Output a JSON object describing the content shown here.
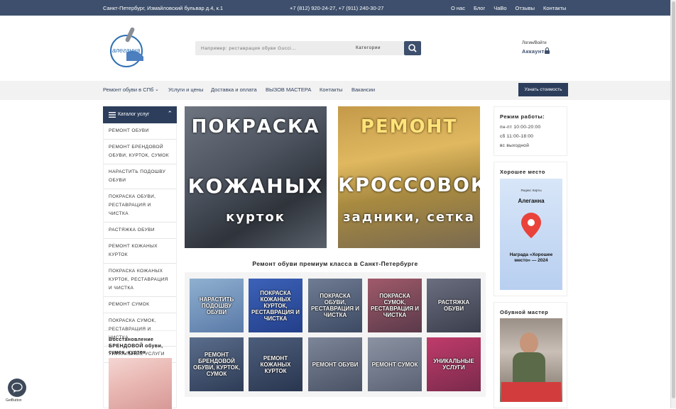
{
  "topbar": {
    "address": "Санкт-Петербург, Измайловский бульвар д.4, к.1",
    "phones": "+7 (812) 920-24-27, +7 (911) 240-30-27",
    "links": [
      "О нас",
      "Блог",
      "ЧаВо",
      "Отзывы",
      "Контакты"
    ]
  },
  "header": {
    "search_placeholder": "Например: реставрация обуви Gucci...",
    "category_label": "Категории",
    "login_label": "Логин/Войти",
    "account_label": "Аккаунт",
    "logo_text": "Алеганна"
  },
  "nav": {
    "items": [
      "Ремонт обуви в СПб",
      "Услуги и цены",
      "Доставка и оплата",
      "ВЫЗОВ МАСТЕРА",
      "Контакты",
      "Вакансии"
    ],
    "cta": "Узнать стоимость"
  },
  "catalog": {
    "title": "Каталог услуг",
    "items": [
      "Ремонт обуви",
      "Ремонт брендовой обуви, курток, сумок",
      "Нарастить подошву обуви",
      "Покраска обуви, реставрация и чистка",
      "Растяжка обуви",
      "Ремонт кожаных курток",
      "Покраска кожаных курток, реставрация и чистка",
      "Ремонт сумок",
      "Покраска сумок, реставрация и чистка",
      "Уникальные услуги"
    ],
    "promo_title": "Восстановление БРЕНДОВОЙ обуви, сумок, курток"
  },
  "banners": [
    {
      "line1": "ПОКРАСКА",
      "line2": "КОЖАНЫХ",
      "line3": "курток"
    },
    {
      "line1": "РЕМОНТ",
      "line2": "КРОССОВОК",
      "line3": "задники, сетка"
    }
  ],
  "section_title": "Ремонт обуви премиум класса в Санкт-Петербурге",
  "tiles": [
    "Нарастить подошву обуви",
    "Покраска кожаных курток, реставрация и чистка",
    "Покраска обуви, реставрация и чистка",
    "Покраска сумок, реставрация и чистка",
    "Растяжка обуви",
    "Ремонт брендовой обуви, курток, сумок",
    "Ремонт кожаных курток",
    "Ремонт обуви",
    "Ремонт сумок",
    "Уникальные услуги"
  ],
  "hours": {
    "title": "Режим работы:",
    "rows": [
      "пн-пт 10:00-20:00",
      "сб 11:00-18:00",
      "вс выходной"
    ]
  },
  "award": {
    "title": "Хорошее место",
    "maps_label": "Яндекс Карты",
    "company": "Алеганна",
    "award_text": "Награда «Хорошее место» — 2024"
  },
  "master": {
    "title": "Обувной мастер"
  },
  "widget": {
    "brand": "GetButton"
  },
  "colors": {
    "brand": "#3d4f6c",
    "nav_text": "#2d3e5c"
  }
}
